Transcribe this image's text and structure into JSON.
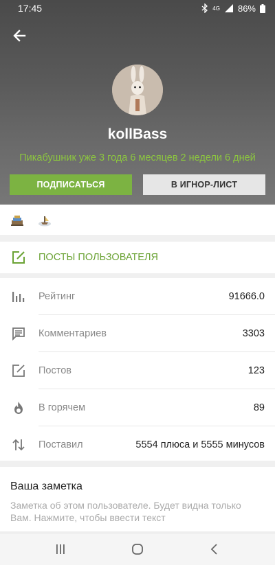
{
  "status_bar": {
    "time": "17:45",
    "network": "4G",
    "battery": "86%"
  },
  "profile": {
    "username": "kollBass",
    "tenure": "Пикабушник уже 3 года 6 месяцев 2 недели 6 дней",
    "subscribe_label": "ПОДПИСАТЬСЯ",
    "ignore_label": "В ИГНОР-ЛИСТ"
  },
  "badges": [
    "award-badge-1",
    "award-badge-2"
  ],
  "posts_link": {
    "label": "ПОСТЫ ПОЛЬЗОВАТЕЛЯ"
  },
  "stats": [
    {
      "icon": "rating-icon",
      "label": "Рейтинг",
      "value": "91666.0"
    },
    {
      "icon": "comments-icon",
      "label": "Комментариев",
      "value": "3303"
    },
    {
      "icon": "posts-icon",
      "label": "Постов",
      "value": "123"
    },
    {
      "icon": "hot-icon",
      "label": "В горячем",
      "value": "89"
    },
    {
      "icon": "votes-icon",
      "label": "Поставил",
      "value": "5554 плюса и 5555 минусов"
    }
  ],
  "note": {
    "title": "Ваша заметка",
    "text": "Заметка об этом пользователе. Будет видна только Вам. Нажмите, чтобы ввести текст"
  },
  "colors": {
    "accent": "#7cb342",
    "accent_text": "#8cc63f"
  }
}
